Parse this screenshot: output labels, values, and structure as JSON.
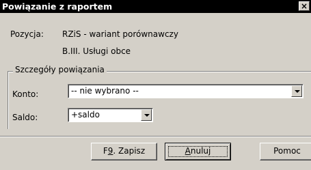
{
  "window": {
    "title": "Powiązanie z raportem",
    "close_label": "×"
  },
  "position": {
    "label": "Pozycja:",
    "value_line1": "RZiS - wariant porównawczy",
    "value_line2": "B.III. Usługi obce"
  },
  "details": {
    "group_title": "Szczegóły powiązania",
    "konto_label": "Konto:",
    "konto_value": "-- nie wybrano --",
    "saldo_label": "Saldo:",
    "saldo_value": "+saldo"
  },
  "buttons": {
    "save_prefix": "F",
    "save_mnemonic": "9",
    "save_suffix": ". Zapisz",
    "cancel_mnemonic": "A",
    "cancel_suffix": "nuluj",
    "help_label": "Pomoc"
  }
}
